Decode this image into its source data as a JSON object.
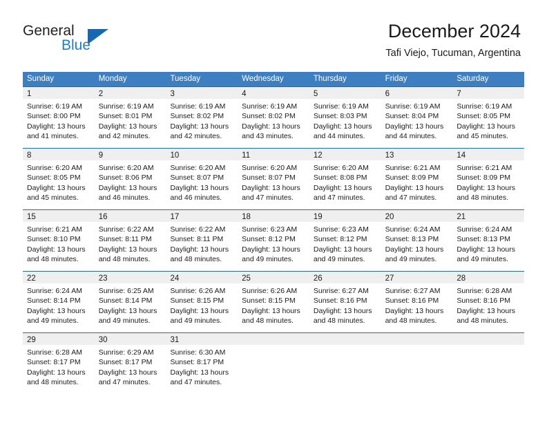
{
  "logo": {
    "word_primary": "General",
    "word_secondary": "Blue",
    "icon": "triangle-flag-icon",
    "color_primary": "#231f20",
    "color_secondary": "#1f7ec4",
    "color_triangle": "#1668b3"
  },
  "header": {
    "title": "December 2024",
    "subtitle": "Tafi Viejo, Tucuman, Argentina"
  },
  "theme": {
    "header_row_bg": "#3d7fc1",
    "header_row_text": "#ffffff",
    "week_divider": "#1d6bb0",
    "daynum_band_bg": "#efefef",
    "cell_bg": "#ffffff",
    "text": "#1a1a1a"
  },
  "weekdays": [
    "Sunday",
    "Monday",
    "Tuesday",
    "Wednesday",
    "Thursday",
    "Friday",
    "Saturday"
  ],
  "weeks": [
    [
      {
        "day": "1",
        "sunrise": "Sunrise: 6:19 AM",
        "sunset": "Sunset: 8:00 PM",
        "daylight1": "Daylight: 13 hours",
        "daylight2": "and 41 minutes."
      },
      {
        "day": "2",
        "sunrise": "Sunrise: 6:19 AM",
        "sunset": "Sunset: 8:01 PM",
        "daylight1": "Daylight: 13 hours",
        "daylight2": "and 42 minutes."
      },
      {
        "day": "3",
        "sunrise": "Sunrise: 6:19 AM",
        "sunset": "Sunset: 8:02 PM",
        "daylight1": "Daylight: 13 hours",
        "daylight2": "and 42 minutes."
      },
      {
        "day": "4",
        "sunrise": "Sunrise: 6:19 AM",
        "sunset": "Sunset: 8:02 PM",
        "daylight1": "Daylight: 13 hours",
        "daylight2": "and 43 minutes."
      },
      {
        "day": "5",
        "sunrise": "Sunrise: 6:19 AM",
        "sunset": "Sunset: 8:03 PM",
        "daylight1": "Daylight: 13 hours",
        "daylight2": "and 44 minutes."
      },
      {
        "day": "6",
        "sunrise": "Sunrise: 6:19 AM",
        "sunset": "Sunset: 8:04 PM",
        "daylight1": "Daylight: 13 hours",
        "daylight2": "and 44 minutes."
      },
      {
        "day": "7",
        "sunrise": "Sunrise: 6:19 AM",
        "sunset": "Sunset: 8:05 PM",
        "daylight1": "Daylight: 13 hours",
        "daylight2": "and 45 minutes."
      }
    ],
    [
      {
        "day": "8",
        "sunrise": "Sunrise: 6:20 AM",
        "sunset": "Sunset: 8:05 PM",
        "daylight1": "Daylight: 13 hours",
        "daylight2": "and 45 minutes."
      },
      {
        "day": "9",
        "sunrise": "Sunrise: 6:20 AM",
        "sunset": "Sunset: 8:06 PM",
        "daylight1": "Daylight: 13 hours",
        "daylight2": "and 46 minutes."
      },
      {
        "day": "10",
        "sunrise": "Sunrise: 6:20 AM",
        "sunset": "Sunset: 8:07 PM",
        "daylight1": "Daylight: 13 hours",
        "daylight2": "and 46 minutes."
      },
      {
        "day": "11",
        "sunrise": "Sunrise: 6:20 AM",
        "sunset": "Sunset: 8:07 PM",
        "daylight1": "Daylight: 13 hours",
        "daylight2": "and 47 minutes."
      },
      {
        "day": "12",
        "sunrise": "Sunrise: 6:20 AM",
        "sunset": "Sunset: 8:08 PM",
        "daylight1": "Daylight: 13 hours",
        "daylight2": "and 47 minutes."
      },
      {
        "day": "13",
        "sunrise": "Sunrise: 6:21 AM",
        "sunset": "Sunset: 8:09 PM",
        "daylight1": "Daylight: 13 hours",
        "daylight2": "and 47 minutes."
      },
      {
        "day": "14",
        "sunrise": "Sunrise: 6:21 AM",
        "sunset": "Sunset: 8:09 PM",
        "daylight1": "Daylight: 13 hours",
        "daylight2": "and 48 minutes."
      }
    ],
    [
      {
        "day": "15",
        "sunrise": "Sunrise: 6:21 AM",
        "sunset": "Sunset: 8:10 PM",
        "daylight1": "Daylight: 13 hours",
        "daylight2": "and 48 minutes."
      },
      {
        "day": "16",
        "sunrise": "Sunrise: 6:22 AM",
        "sunset": "Sunset: 8:11 PM",
        "daylight1": "Daylight: 13 hours",
        "daylight2": "and 48 minutes."
      },
      {
        "day": "17",
        "sunrise": "Sunrise: 6:22 AM",
        "sunset": "Sunset: 8:11 PM",
        "daylight1": "Daylight: 13 hours",
        "daylight2": "and 48 minutes."
      },
      {
        "day": "18",
        "sunrise": "Sunrise: 6:23 AM",
        "sunset": "Sunset: 8:12 PM",
        "daylight1": "Daylight: 13 hours",
        "daylight2": "and 49 minutes."
      },
      {
        "day": "19",
        "sunrise": "Sunrise: 6:23 AM",
        "sunset": "Sunset: 8:12 PM",
        "daylight1": "Daylight: 13 hours",
        "daylight2": "and 49 minutes."
      },
      {
        "day": "20",
        "sunrise": "Sunrise: 6:24 AM",
        "sunset": "Sunset: 8:13 PM",
        "daylight1": "Daylight: 13 hours",
        "daylight2": "and 49 minutes."
      },
      {
        "day": "21",
        "sunrise": "Sunrise: 6:24 AM",
        "sunset": "Sunset: 8:13 PM",
        "daylight1": "Daylight: 13 hours",
        "daylight2": "and 49 minutes."
      }
    ],
    [
      {
        "day": "22",
        "sunrise": "Sunrise: 6:24 AM",
        "sunset": "Sunset: 8:14 PM",
        "daylight1": "Daylight: 13 hours",
        "daylight2": "and 49 minutes."
      },
      {
        "day": "23",
        "sunrise": "Sunrise: 6:25 AM",
        "sunset": "Sunset: 8:14 PM",
        "daylight1": "Daylight: 13 hours",
        "daylight2": "and 49 minutes."
      },
      {
        "day": "24",
        "sunrise": "Sunrise: 6:26 AM",
        "sunset": "Sunset: 8:15 PM",
        "daylight1": "Daylight: 13 hours",
        "daylight2": "and 49 minutes."
      },
      {
        "day": "25",
        "sunrise": "Sunrise: 6:26 AM",
        "sunset": "Sunset: 8:15 PM",
        "daylight1": "Daylight: 13 hours",
        "daylight2": "and 48 minutes."
      },
      {
        "day": "26",
        "sunrise": "Sunrise: 6:27 AM",
        "sunset": "Sunset: 8:16 PM",
        "daylight1": "Daylight: 13 hours",
        "daylight2": "and 48 minutes."
      },
      {
        "day": "27",
        "sunrise": "Sunrise: 6:27 AM",
        "sunset": "Sunset: 8:16 PM",
        "daylight1": "Daylight: 13 hours",
        "daylight2": "and 48 minutes."
      },
      {
        "day": "28",
        "sunrise": "Sunrise: 6:28 AM",
        "sunset": "Sunset: 8:16 PM",
        "daylight1": "Daylight: 13 hours",
        "daylight2": "and 48 minutes."
      }
    ],
    [
      {
        "day": "29",
        "sunrise": "Sunrise: 6:28 AM",
        "sunset": "Sunset: 8:17 PM",
        "daylight1": "Daylight: 13 hours",
        "daylight2": "and 48 minutes."
      },
      {
        "day": "30",
        "sunrise": "Sunrise: 6:29 AM",
        "sunset": "Sunset: 8:17 PM",
        "daylight1": "Daylight: 13 hours",
        "daylight2": "and 47 minutes."
      },
      {
        "day": "31",
        "sunrise": "Sunrise: 6:30 AM",
        "sunset": "Sunset: 8:17 PM",
        "daylight1": "Daylight: 13 hours",
        "daylight2": "and 47 minutes."
      },
      {
        "day": "",
        "sunrise": "",
        "sunset": "",
        "daylight1": "",
        "daylight2": ""
      },
      {
        "day": "",
        "sunrise": "",
        "sunset": "",
        "daylight1": "",
        "daylight2": ""
      },
      {
        "day": "",
        "sunrise": "",
        "sunset": "",
        "daylight1": "",
        "daylight2": ""
      },
      {
        "day": "",
        "sunrise": "",
        "sunset": "",
        "daylight1": "",
        "daylight2": ""
      }
    ]
  ]
}
